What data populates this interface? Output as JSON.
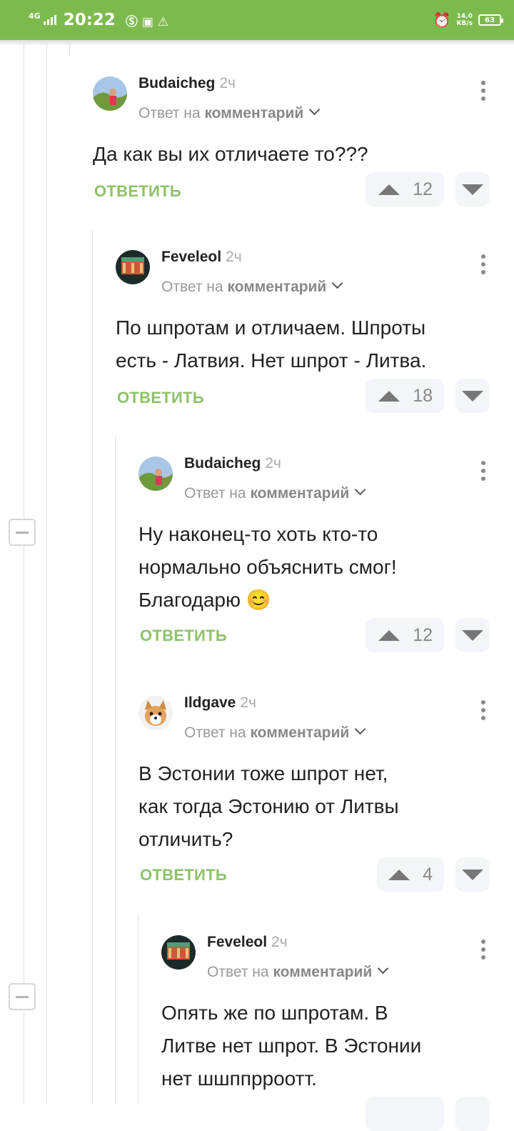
{
  "status_bar": {
    "network": "4G",
    "time": "20:22",
    "notif_icons": "Ⓢ ▣ ⚠",
    "speed_value": "14,0",
    "speed_unit": "KB/s",
    "battery": "63"
  },
  "comments": [
    {
      "author": "Budaicheg",
      "time": "2ч",
      "reply_prefix": "Ответ на",
      "reply_link": "комментарий",
      "lines": [
        "Да как вы их отличаете то???"
      ],
      "reply_label": "ОТВЕТИТЬ",
      "votes": "12"
    },
    {
      "author": "Feveleol",
      "time": "2ч",
      "reply_prefix": "Ответ на",
      "reply_link": "комментарий",
      "lines": [
        "По шпротам и отличаем. Шпроты",
        "есть - Латвия. Нет шпрот - Литва."
      ],
      "reply_label": "ОТВЕТИТЬ",
      "votes": "18"
    },
    {
      "author": "Budaicheg",
      "time": "2ч",
      "reply_prefix": "Ответ на",
      "reply_link": "комментарий",
      "lines": [
        "Ну наконец-то хоть кто-то",
        "нормально объяснить смог!",
        "Благодарю 😊"
      ],
      "reply_label": "ОТВЕТИТЬ",
      "votes": "12"
    },
    {
      "author": "Ildgave",
      "time": "2ч",
      "reply_prefix": "Ответ на",
      "reply_link": "комментарий",
      "lines": [
        "В Эстонии тоже шпрот нет,",
        "как тогда Эстонию от Литвы",
        "отличить?"
      ],
      "reply_label": "ОТВЕТИТЬ",
      "votes": "4"
    },
    {
      "author": "Feveleol",
      "time": "2ч",
      "reply_prefix": "Ответ на",
      "reply_link": "комментарий",
      "lines": [
        "Опять же по шпротам. В",
        "Литве нет шпрот. В Эстонии",
        "нет шшппрроотт."
      ]
    }
  ],
  "colors": {
    "statusbar": "#7dba4e",
    "reply": "#8dc26a",
    "text": "#222222"
  }
}
